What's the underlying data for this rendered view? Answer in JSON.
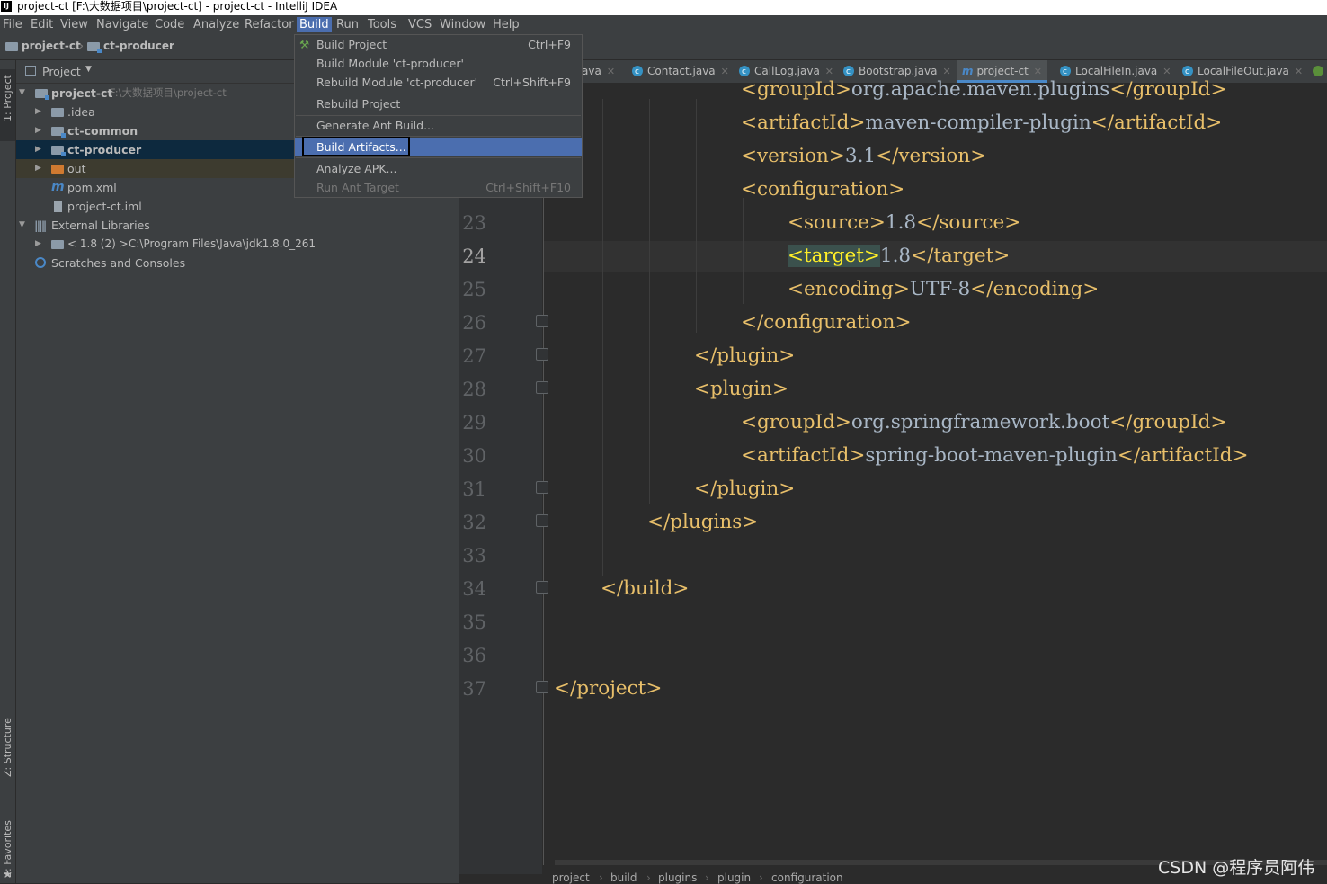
{
  "window": {
    "title": "project-ct [F:\\大数据项目\\project-ct] - project-ct - IntelliJ IDEA",
    "logo": "IJ"
  },
  "menubar": [
    "File",
    "Edit",
    "View",
    "Navigate",
    "Code",
    "Analyze",
    "Refactor",
    "Build",
    "Run",
    "Tools",
    "VCS",
    "Window",
    "Help"
  ],
  "navbar": {
    "crumbs": [
      "project-ct",
      "ct-producer"
    ]
  },
  "tool_strip": {
    "project": "1: Project",
    "structure": "Z: Structure",
    "favorites": "2: Favorites"
  },
  "project_panel": {
    "header": "Project",
    "tree": [
      {
        "label": "project-ct",
        "path": "F:\\大数据项目\\project-ct"
      },
      {
        "label": ".idea"
      },
      {
        "label": "ct-common"
      },
      {
        "label": "ct-producer"
      },
      {
        "label": "out"
      },
      {
        "label": "pom.xml"
      },
      {
        "label": "project-ct.iml"
      },
      {
        "label": "External Libraries"
      },
      {
        "label": "< 1.8 (2) >",
        "path": "C:\\Program Files\\Java\\jdk1.8.0_261"
      },
      {
        "label": "Scratches and Consoles"
      }
    ]
  },
  "editor_tabs": [
    {
      "label": "ava"
    },
    {
      "label": "Contact.java"
    },
    {
      "label": "CallLog.java"
    },
    {
      "label": "Bootstrap.java"
    },
    {
      "label": "project-ct",
      "active": true
    },
    {
      "label": "LocalFileIn.java"
    },
    {
      "label": "LocalFileOut.java"
    }
  ],
  "code": {
    "line_numbers": [
      "23",
      "24",
      "25",
      "26",
      "27",
      "28",
      "29",
      "30",
      "31",
      "32",
      "33",
      "34",
      "35",
      "36",
      "37"
    ],
    "lines": [
      {
        "tag1": "<groupId>",
        "text": "org.apache.maven.plugins",
        "tag2": "</groupId>"
      },
      {
        "tag1": "<artifactId>",
        "text": "maven-compiler-plugin",
        "tag2": "</artifactId>"
      },
      {
        "tag1": "<version>",
        "text": "3.1",
        "tag2": "</version>"
      },
      {
        "tag1": "<configuration>",
        "text": "",
        "tag2": ""
      },
      {
        "tag1": "<source>",
        "text": "1.8",
        "tag2": "</source>"
      },
      {
        "tag1": "<target>",
        "text": "1.8",
        "tag2": "</target>"
      },
      {
        "tag1": "<encoding>",
        "text": "UTF-8",
        "tag2": "</encoding>"
      },
      {
        "tag1": "</configuration>",
        "text": "",
        "tag2": ""
      },
      {
        "tag1": "</plugin>",
        "text": "",
        "tag2": ""
      },
      {
        "tag1": "<plugin>",
        "text": "",
        "tag2": ""
      },
      {
        "tag1": "<groupId>",
        "text": "org.springframework.boot",
        "tag2": "</groupId>"
      },
      {
        "tag1": "<artifactId>",
        "text": "spring-boot-maven-plugin",
        "tag2": "</artifactId>"
      },
      {
        "tag1": "</plugin>",
        "text": "",
        "tag2": ""
      },
      {
        "tag1": "</plugins>",
        "text": "",
        "tag2": ""
      },
      {
        "tag1": "</build>",
        "text": "",
        "tag2": ""
      },
      {
        "tag1": "</project>",
        "text": "",
        "tag2": ""
      }
    ]
  },
  "breadcrumb": [
    "project",
    "build",
    "plugins",
    "plugin",
    "configuration"
  ],
  "build_menu": {
    "items": [
      {
        "label": "Build Project",
        "shortcut": "Ctrl+F9"
      },
      {
        "label": "Build Module 'ct-producer'",
        "shortcut": ""
      },
      {
        "label": "Rebuild Module 'ct-producer'",
        "shortcut": "Ctrl+Shift+F9"
      },
      {
        "label": "Rebuild Project",
        "shortcut": ""
      },
      {
        "label": "Generate Ant Build...",
        "shortcut": ""
      },
      {
        "label": "Build Artifacts...",
        "shortcut": ""
      },
      {
        "label": "Analyze APK...",
        "shortcut": ""
      },
      {
        "label": "Run Ant Target",
        "shortcut": "Ctrl+Shift+F10"
      }
    ],
    "highlighted": "Build Artifacts..."
  },
  "watermark": "CSDN @程序员阿伟",
  "colors": {
    "accent": "#4b6eaf",
    "tag": "#e8bf6a",
    "text": "#a9b7c6",
    "background": "#2b2b2b"
  }
}
